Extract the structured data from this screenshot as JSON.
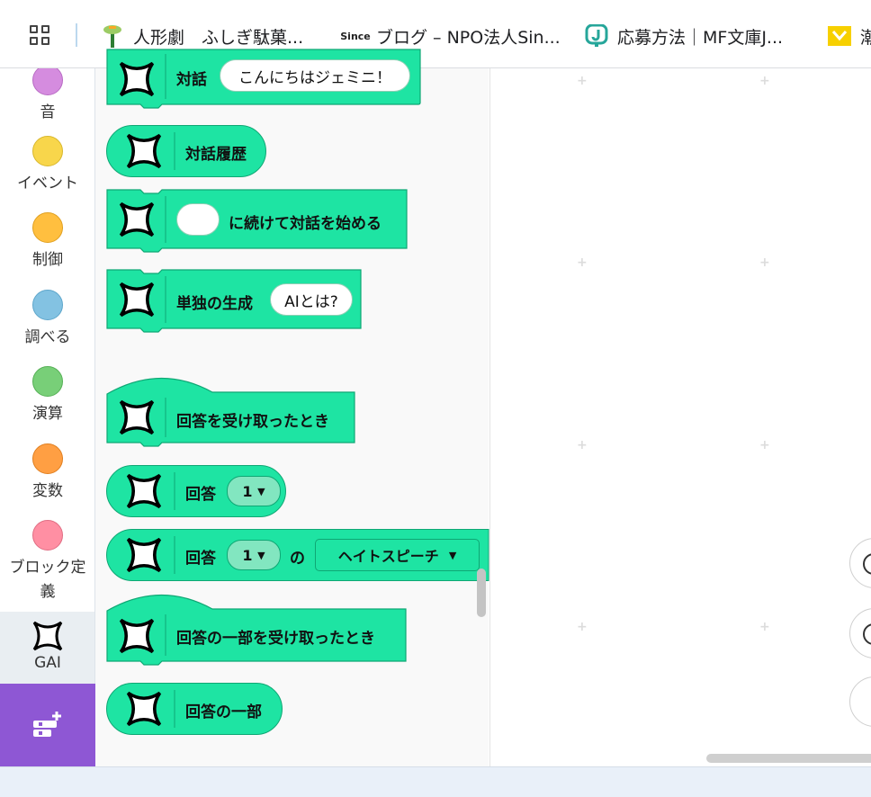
{
  "bookmarks": [
    {
      "label": "人形劇　ふしぎ駄菓...",
      "icon": "tree-icon"
    },
    {
      "label": "ブログ – NPO法人Sin...",
      "icon": "since-logo",
      "logo_text": "Since"
    },
    {
      "label": "応募方法｜MF文庫J...",
      "icon": "j-logo"
    },
    {
      "label": "潮",
      "icon": "yellow-logo"
    }
  ],
  "categories": [
    {
      "label": "音",
      "color": "#d58cdf"
    },
    {
      "label": "イベント",
      "color": "#f8d64b"
    },
    {
      "label": "制御",
      "color": "#ffbf3f"
    },
    {
      "label": "調べる",
      "color": "#83c2e2"
    },
    {
      "label": "演算",
      "color": "#78cf78"
    },
    {
      "label": "変数",
      "color": "#ff9f43"
    },
    {
      "label": "ブロック定義",
      "color": "#ff8fa3"
    },
    {
      "label": "GAI",
      "color": "#ffffff",
      "icon": "sparkle-icon"
    }
  ],
  "blocks": {
    "b1": {
      "text": "対話",
      "arg": "こんにちはジェミニ！"
    },
    "b2": {
      "text": "対話履歴"
    },
    "b3": {
      "text": "に続けて対話を始める"
    },
    "b4": {
      "text": "単独の生成",
      "arg": "AIとは?"
    },
    "b5": {
      "text": "回答を受け取ったとき"
    },
    "b6": {
      "text": "回答",
      "dropdown": "1"
    },
    "b7": {
      "text": "回答",
      "dropdown": "1",
      "of": "の",
      "dropdown2": "ヘイトスピーチ"
    },
    "b8": {
      "text": "回答の一部を受け取ったとき"
    },
    "b9": {
      "text": "回答の一部"
    }
  },
  "colors": {
    "block": "#1ee4a3",
    "block_border": "#0fa774",
    "ext_button": "#8e57d4"
  }
}
